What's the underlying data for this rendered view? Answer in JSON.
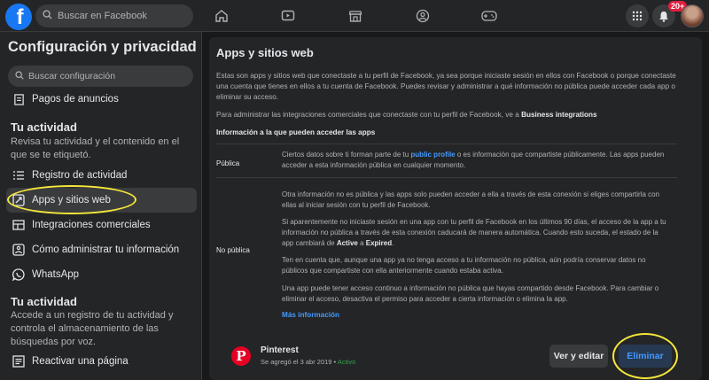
{
  "topbar": {
    "logo": "f",
    "search_placeholder": "Buscar en Facebook",
    "notification_badge": "20+",
    "nav_icons": [
      "home-icon",
      "watch-icon",
      "marketplace-icon",
      "groups-icon",
      "gaming-icon"
    ]
  },
  "sidebar": {
    "title": "Configuración y privacidad",
    "search_placeholder": "Buscar configuración",
    "items_top": [
      {
        "label": "Pagos de anuncios",
        "icon": "receipt-icon"
      }
    ],
    "activity_heading": "Tu actividad",
    "activity_desc": "Revisa tu actividad y el contenido en el que se te etiquetó.",
    "items_activity": [
      {
        "label": "Registro de actividad",
        "icon": "list-icon"
      },
      {
        "label": "Apps y sitios web",
        "icon": "apps-icon"
      },
      {
        "label": "Integraciones comerciales",
        "icon": "integrations-icon"
      },
      {
        "label": "Cómo administrar tu información",
        "icon": "info-icon"
      },
      {
        "label": "WhatsApp",
        "icon": "whatsapp-icon"
      }
    ],
    "activity2_heading": "Tu actividad",
    "activity2_desc": "Accede a un registro de tu actividad y controla el almacenamiento de las búsquedas por voz.",
    "items_bottom": [
      {
        "label": "Reactivar una página",
        "icon": "page-icon"
      }
    ]
  },
  "main": {
    "title": "Apps y sitios web",
    "intro_1": "Estas son apps y sitios web que conectaste a tu perfil de Facebook, ya sea porque iniciaste sesión en ellos con Facebook o porque conectaste",
    "intro_2": "una cuenta que tienes en ellos a tu cuenta de Facebook. Puedes revisar y administrar a qué información no pública puede acceder cada app o",
    "intro_3": "eliminar su acceso.",
    "business_prefix": "Para administrar las integraciones comerciales que conectaste con tu perfil de Facebook, ve a ",
    "business_link": "Business integrations",
    "access_heading": "Información a la que pueden acceder las apps",
    "public_label": "Pública",
    "public_1_prefix": "Ciertos datos sobre ti forman parte de tu ",
    "public_1_link": "public profile",
    "public_1_suffix": " o es información que compartiste públicamente. Las apps pueden",
    "public_2": "acceder a esta información pública en cualquier momento.",
    "nonpublic_label": "No pública",
    "np_a1": "Otra información no es pública y las apps solo pueden acceder a ella a través de esta conexión si eliges compartirla con",
    "np_a2": "ellas al iniciar sesión con tu perfil de Facebook.",
    "np_b1": "Si aparentemente no iniciaste sesión en una app con tu perfil de Facebook en los últimos 90 días, el acceso de la app a tu",
    "np_b2": "información no pública a través de esta conexión caducará de manera automática. Cuando esto suceda, el estado de la",
    "np_b3_prefix": "app cambiará de ",
    "np_b3_active": "Active",
    "np_b3_mid": " a ",
    "np_b3_expired": "Expired",
    "np_b3_suffix": ".",
    "np_c1": "Ten en cuenta que, aunque una app ya no tenga acceso a tu información no pública, aún podría conservar datos no",
    "np_c2": "públicos que compartiste con ella anteriormente cuando estaba activa.",
    "np_d1": "Una app puede tener acceso continuo a información no pública que hayas compartido desde Facebook. Para cambiar o",
    "np_d2": "eliminar el acceso, desactiva el permiso para acceder a cierta información o elimina la app.",
    "more_info": "Más información"
  },
  "app": {
    "name": "Pinterest",
    "logo": "P",
    "added": "Se agregó el 3 abr 2019 • ",
    "status": "Activo",
    "edit_label": "Ver y editar",
    "delete_label": "Eliminar"
  },
  "colors": {
    "accent": "#1877f2",
    "link": "#4599ff",
    "highlight": "#f4e63b",
    "active": "#31a24c",
    "pinterest": "#e60023"
  }
}
